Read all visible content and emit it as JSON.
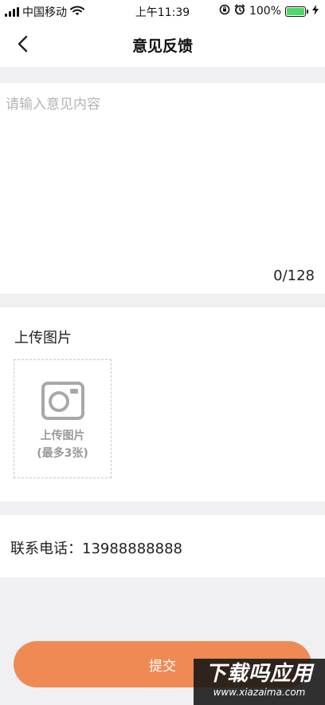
{
  "status_bar": {
    "carrier": "中国移动",
    "time": "上午11:39",
    "battery": "100%",
    "battery_level": 1.0,
    "icons": [
      "signal-icon",
      "wifi-icon",
      "rotation-lock-icon",
      "alarm-icon",
      "battery-icon",
      "charging-icon"
    ]
  },
  "nav": {
    "title": "意见反馈",
    "back_icon": "chevron-left-icon"
  },
  "feedback": {
    "placeholder": "请输入意见内容",
    "value": "",
    "char_count": "0/128"
  },
  "upload": {
    "title": "上传图片",
    "box_label": "上传图片",
    "box_limit": "(最多3张)",
    "icon": "camera-icon"
  },
  "contact": {
    "text": "联系电话：13988888888"
  },
  "submit": {
    "label": "提交"
  },
  "watermark": {
    "main": "下载吗应用",
    "sub": "www.xiazaima.com"
  },
  "colors": {
    "accent": "#ef8a55",
    "page_bg": "#f0f0f3",
    "placeholder": "#b4b4b4",
    "battery": "#4cd964"
  }
}
